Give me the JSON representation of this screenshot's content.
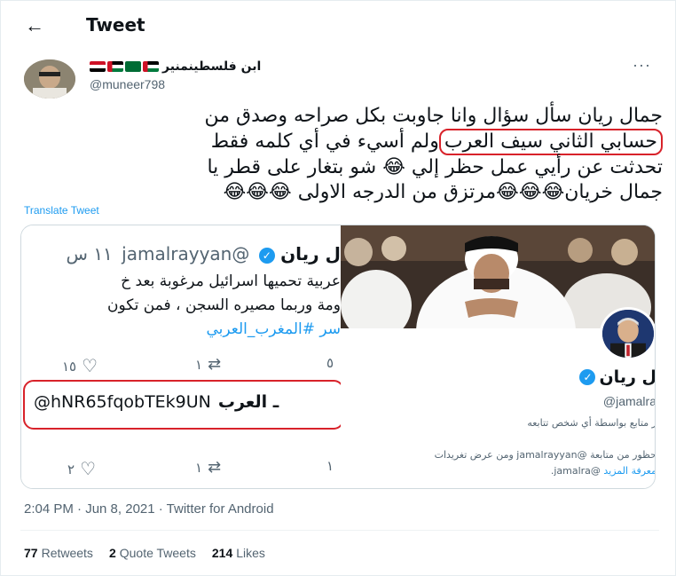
{
  "header": {
    "title": "Tweet",
    "back_label": "←"
  },
  "author": {
    "name": "ابن فلسطين‎منير",
    "handle": "@muneer798",
    "flags": [
      "#ce1126",
      "#007a3d",
      "#ce1126",
      "#ffffff"
    ]
  },
  "tweet": {
    "line1": "جمال ريان سأل سؤال وانا جاوبت بكل صراحه وصدق من",
    "line2_highlight": "حسابي الثاني سيف العرب",
    "line2_rest": "ولم أسيء في أي كلمه فقط",
    "line3": "تحدثت عن رأيي عمل حظر إلي 😂 شو بتغار على قطر يا",
    "line4": "جمال خريان😂😂😂مرتزق من الدرجه الاولى 😂😂😂"
  },
  "translate_label": "Translate Tweet",
  "quoted": {
    "name": "ل ريان",
    "handle": "@jamalrayyan",
    "time": "١١ س",
    "body_line1": "عربية تحميها اسرائيل مرغوبة بعد خ",
    "body_line2": "ومة وربما مصيره السجن ، فمن تكون",
    "hashtag": "سر #المغرب_العربي",
    "stats1": {
      "likes": "١٥",
      "retweets": "١",
      "replies": "٥"
    },
    "url_text": "@hNR65fqobTEk9UN",
    "url_arabic": "ـ العرب",
    "stats2": {
      "likes": "٢",
      "retweets": "١",
      "replies": "١"
    }
  },
  "profile_card": {
    "name": "ل ريان",
    "handle": "@jamalra",
    "follow_note": "ر متابع بواسطة أي شخص تتابعه",
    "blocked_note": "حظور من متابعة @jamalrayyan ومن عرض تغريدات",
    "learn_more": "معرفة المزيد",
    "handle2": "@jamalra."
  },
  "meta": {
    "timestamp": "2:04 PM · Jun 8, 2021 · Twitter for Android",
    "retweets_count": "77",
    "retweets_label": "Retweets",
    "quotes_count": "2",
    "quotes_label": "Quote Tweets",
    "likes_count": "214",
    "likes_label": "Likes"
  },
  "colors": {
    "accent": "#1d9bf0",
    "highlight_border": "#d8222a",
    "muted": "#536471"
  }
}
